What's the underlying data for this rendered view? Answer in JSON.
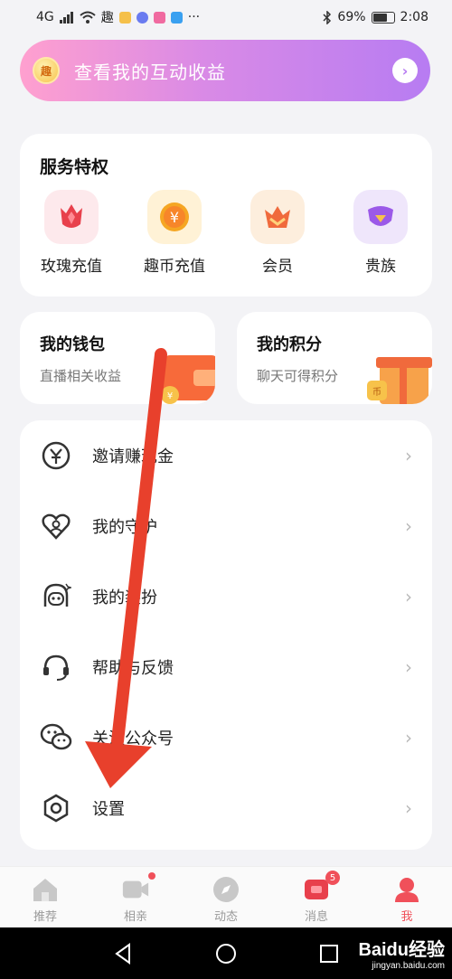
{
  "status_bar": {
    "network": "4G",
    "app_text": "趣",
    "battery": "69%",
    "time": "2:08",
    "battery_level": 0.69
  },
  "banner": {
    "badge_text": "趣",
    "text": "查看我的互动收益"
  },
  "services": {
    "title": "服务特权",
    "items": [
      {
        "label": "玫瑰充值",
        "icon": "rose-icon"
      },
      {
        "label": "趣币充值",
        "icon": "coin-icon"
      },
      {
        "label": "会员",
        "icon": "crown-icon"
      },
      {
        "label": "贵族",
        "icon": "noble-shield-icon"
      }
    ]
  },
  "wallet": {
    "title": "我的钱包",
    "subtitle": "直播相关收益"
  },
  "points": {
    "title": "我的积分",
    "subtitle": "聊天可得积分"
  },
  "menu": [
    {
      "label": "邀请赚现金",
      "icon": "yuan-icon"
    },
    {
      "label": "我的守护",
      "icon": "heart-user-icon"
    },
    {
      "label": "我的装扮",
      "icon": "face-icon"
    },
    {
      "label": "帮助与反馈",
      "icon": "headset-icon"
    },
    {
      "label": "关注公众号",
      "icon": "wechat-icon"
    },
    {
      "label": "设置",
      "icon": "settings-icon"
    }
  ],
  "tabs": [
    {
      "label": "推荐",
      "icon": "home-icon"
    },
    {
      "label": "相亲",
      "icon": "video-icon"
    },
    {
      "label": "动态",
      "icon": "compass-icon"
    },
    {
      "label": "消息",
      "icon": "message-icon",
      "badge": "5"
    },
    {
      "label": "我",
      "icon": "profile-icon"
    }
  ],
  "watermark": {
    "brand": "Baidu经验",
    "url": "jingyan.baidu.com"
  },
  "colors": {
    "accent": "#f0505a",
    "banner_start": "#ffa0cf",
    "banner_end": "#b77cf2",
    "annotation_arrow": "#e8402c"
  }
}
